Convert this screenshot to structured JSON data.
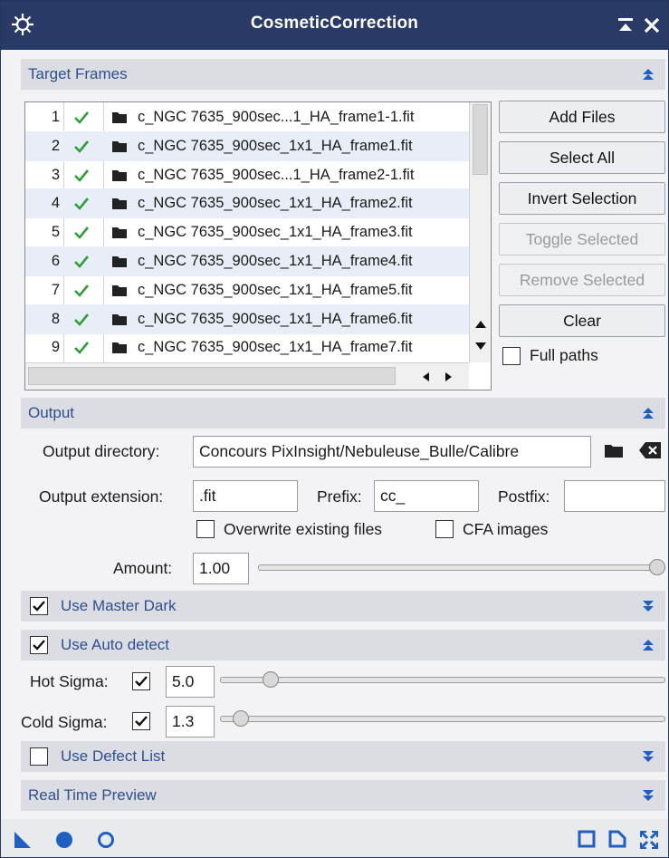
{
  "window": {
    "title": "CosmeticCorrection"
  },
  "sections": {
    "target_frames": "Target Frames",
    "output": "Output",
    "master_dark": "Use Master Dark",
    "auto_detect": "Use Auto detect",
    "defect_list": "Use Defect List",
    "real_time_preview": "Real Time Preview"
  },
  "files": [
    {
      "num": "1",
      "name": "c_NGC 7635_900sec...1_HA_frame1-1.fit"
    },
    {
      "num": "2",
      "name": "c_NGC 7635_900sec_1x1_HA_frame1.fit"
    },
    {
      "num": "3",
      "name": "c_NGC 7635_900sec...1_HA_frame2-1.fit"
    },
    {
      "num": "4",
      "name": "c_NGC 7635_900sec_1x1_HA_frame2.fit"
    },
    {
      "num": "5",
      "name": "c_NGC 7635_900sec_1x1_HA_frame3.fit"
    },
    {
      "num": "6",
      "name": "c_NGC 7635_900sec_1x1_HA_frame4.fit"
    },
    {
      "num": "7",
      "name": "c_NGC 7635_900sec_1x1_HA_frame5.fit"
    },
    {
      "num": "8",
      "name": "c_NGC 7635_900sec_1x1_HA_frame6.fit"
    },
    {
      "num": "9",
      "name": "c_NGC 7635_900sec_1x1_HA_frame7.fit"
    }
  ],
  "buttons": {
    "add_files": "Add Files",
    "select_all": "Select All",
    "invert_selection": "Invert Selection",
    "toggle_selected": "Toggle Selected",
    "remove_selected": "Remove Selected",
    "clear": "Clear"
  },
  "full_paths": {
    "label": "Full paths",
    "checked": false
  },
  "output": {
    "directory_label": "Output directory:",
    "directory_value": "Concours PixInsight/Nebuleuse_Bulle/Calibre",
    "extension_label": "Output extension:",
    "extension_value": ".fit",
    "prefix_label": "Prefix:",
    "prefix_value": "cc_",
    "postfix_label": "Postfix:",
    "postfix_value": "",
    "overwrite_label": "Overwrite existing files",
    "overwrite_checked": false,
    "cfa_label": "CFA images",
    "cfa_checked": false,
    "amount_label": "Amount:",
    "amount_value": "1.00",
    "amount_level": 1.0
  },
  "master_dark_checked": true,
  "auto_detect": {
    "checked": true,
    "hot_label": "Hot Sigma:",
    "hot_checked": true,
    "hot_value": "5.0",
    "hot_level": 0.1,
    "cold_label": "Cold Sigma:",
    "cold_checked": true,
    "cold_value": "1.3",
    "cold_level": 0.03
  },
  "defect_list_checked": false,
  "colors": {
    "title_bar": "#2a3a66",
    "section_text": "#2f4f8f",
    "check_green": "#2e9e3a",
    "icon_blue": "#1f5fbf"
  }
}
